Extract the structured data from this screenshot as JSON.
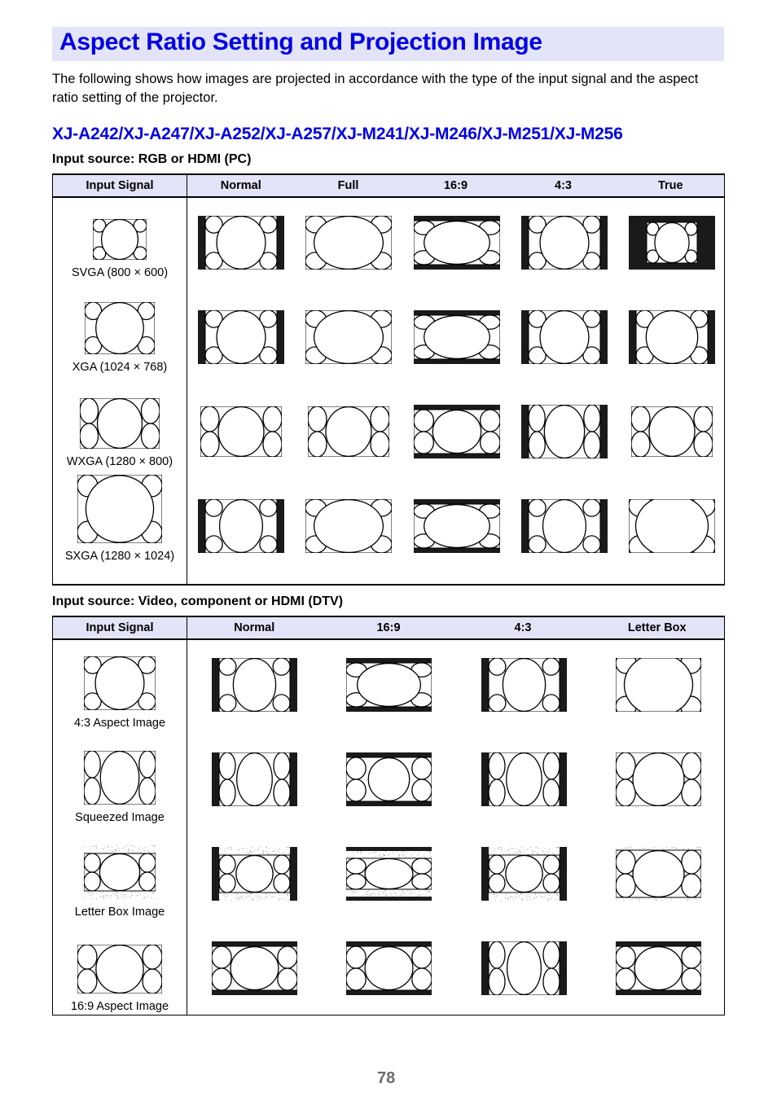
{
  "page": {
    "title": "Aspect Ratio Setting and Projection Image",
    "intro": "The following shows how images are projected in accordance with the type of the input signal and the aspect ratio setting of the projector.",
    "models": "XJ-A242/XJ-A247/XJ-A252/XJ-A257/XJ-M241/XJ-M246/XJ-M251/XJ-M256",
    "page_number": "78",
    "accent_color": "#0000e6",
    "header_bg": "#e4e4f8"
  },
  "pc": {
    "heading": "Input source: RGB or HDMI (PC)",
    "columns": [
      "Input Signal",
      "Normal",
      "Full",
      "16:9",
      "4:3",
      "True"
    ],
    "rows": [
      {
        "signal": "SVGA (800 × 600)",
        "icon": "svga",
        "results": [
          "pillar-4x3",
          "full-16x10",
          "letter-169",
          "pillar-4x3",
          "true-small"
        ]
      },
      {
        "signal": "XGA (1024 × 768)",
        "icon": "xga",
        "results": [
          "pillar-4x3",
          "full-16x10",
          "letter-169",
          "pillar-4x3",
          "true-pillar"
        ]
      },
      {
        "signal": "WXGA (1280 × 800)",
        "icon": "wxga",
        "results": [
          "wide-full",
          "wide-full",
          "wide-letter",
          "wide-pillar",
          "wide-full"
        ]
      },
      {
        "signal": "SXGA (1280 × 1024)",
        "icon": "sxga",
        "results": [
          "sx-pillar",
          "full-16x10",
          "letter-169",
          "sx-pillar",
          "sx-crop"
        ]
      }
    ]
  },
  "dtv": {
    "heading": "Input source: Video, component or HDMI (DTV)",
    "columns": [
      "Input Signal",
      "Normal",
      "16:9",
      "4:3",
      "Letter Box"
    ],
    "rows": [
      {
        "signal": "4:3 Aspect Image",
        "icon": "a43",
        "results": [
          "v-pillar",
          "v-letter",
          "v-pillar",
          "v-zoom"
        ]
      },
      {
        "signal": "Squeezed Image",
        "icon": "sq",
        "results": [
          "sq-pillar",
          "sq-letter",
          "sq-pillar",
          "sq-zoom"
        ]
      },
      {
        "signal": "Letter Box Image",
        "icon": "lb",
        "results": [
          "lb-pillar",
          "lb-letter",
          "lb-pillar",
          "lb-zoom"
        ]
      },
      {
        "signal": "16:9 Aspect Image",
        "icon": "w169",
        "results": [
          "w-letter",
          "w-letter",
          "w-pillar",
          "w-letter"
        ]
      }
    ]
  }
}
